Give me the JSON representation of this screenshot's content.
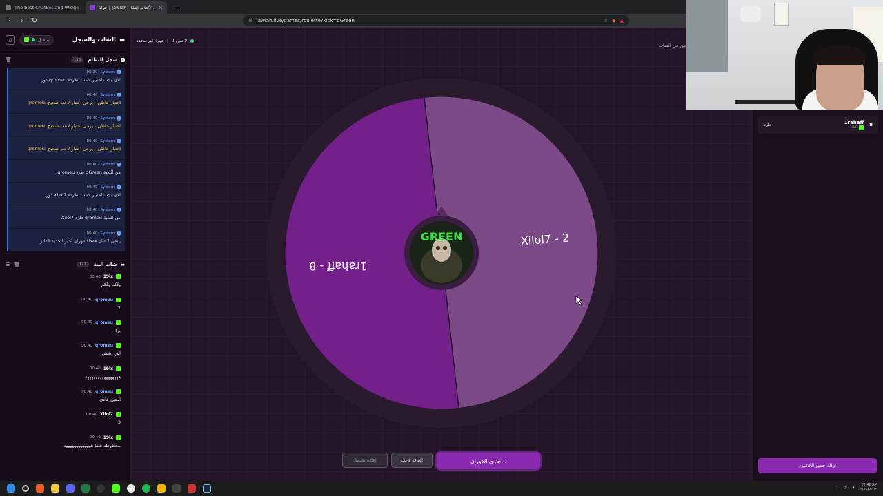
{
  "browser": {
    "tabs": [
      {
        "title": "The best ChatBot and Widgets for Ki"
      },
      {
        "title": "جولة | Jawlah - منصة الألعاب التفا"
      }
    ],
    "url": "jawlah.live/games/roulette?kick=qGreen"
  },
  "sidebar": {
    "title": "الشات والسجل",
    "connection_status": "متصل",
    "system_log": {
      "title": "سجل النظام",
      "count": "115",
      "items": [
        {
          "time": "00:39",
          "sender": "System",
          "text": "دور qromeu الان يجب اختيار لاعب بطرده",
          "warn": false
        },
        {
          "time": "00:40",
          "sender": "System",
          "text": "qromeu: اختيار خاطئ - يرجى اختيار لاعب صحيح",
          "warn": true
        },
        {
          "time": "00:40",
          "sender": "System",
          "text": "qromeu: اختيار خاطئ - يرجى اختيار لاعب صحيح",
          "warn": true
        },
        {
          "time": "00:40",
          "sender": "System",
          "text": "qromeu: اختيار خاطئ - يرجى اختيار لاعب صحيح",
          "warn": true
        },
        {
          "time": "00:40",
          "sender": "System",
          "text": "qromeu طرد qGreen من اللعبة",
          "warn": false
        },
        {
          "time": "00:40",
          "sender": "System",
          "text": "دور Xilol7 الان يجب اختيار لاعب بطرده",
          "warn": false
        },
        {
          "time": "00:40",
          "sender": "System",
          "text": "Xilol7 طرد qromeu من اللعبة",
          "warn": false
        },
        {
          "time": "00:40",
          "sender": "System",
          "text": "يتبقى لاعبان فقط! دوران أخير لتحديد الفائز",
          "warn": false
        }
      ]
    },
    "live_chat": {
      "title": "شات البث",
      "count": "122",
      "items": [
        {
          "time": "00:40",
          "user": "19lx",
          "color": "#ffffff",
          "text": "ولكم ولكم"
        },
        {
          "time": "00:40",
          "user": "qromeu",
          "color": "#6ea0ff",
          "text": "7"
        },
        {
          "time": "00:40",
          "user": "qromeu",
          "color": "#6ea0ff",
          "text": "براا"
        },
        {
          "time": "00:40",
          "user": "qromeu",
          "color": "#6ea0ff",
          "text": "اش اشش"
        },
        {
          "time": "00:40",
          "user": "19lx",
          "color": "#ffffff",
          "text": "ههههههههههههههههه"
        },
        {
          "time": "00:40",
          "user": "qromeu",
          "color": "#6ea0ff",
          "text": "الحين عادي"
        },
        {
          "time": "00:40",
          "user": "Xilol7",
          "color": "#ffffff",
          "text": "3"
        },
        {
          "time": "00:40",
          "user": "19lx",
          "color": "#ffffff",
          "text": "محظوظه شقا هههههههههههههه"
        }
      ]
    }
  },
  "main": {
    "players_label": "2 لاعبين",
    "turn_label": "دور: غير محدد",
    "top_right_text": "بين في الشات",
    "wheel": {
      "segments": [
        {
          "label": "1rahaff - 8",
          "color": "#74208a"
        },
        {
          "label": "Xilol7 - 2",
          "color": "#7c4a86"
        }
      ],
      "center_label": "GREEN"
    },
    "buttons": {
      "spin": "جاري الدوران...",
      "add_player": "إضافة لاعب",
      "reset": "إعادة تشغيل"
    }
  },
  "right_panel": {
    "player": {
      "name": "1rahaff",
      "sub": "كيك",
      "count": "8",
      "kick_label": "طرد"
    },
    "remove_all": "إزالة جميع اللاعبين"
  },
  "taskbar": {
    "time": "12:40 AM",
    "date": "1/25/2025"
  }
}
